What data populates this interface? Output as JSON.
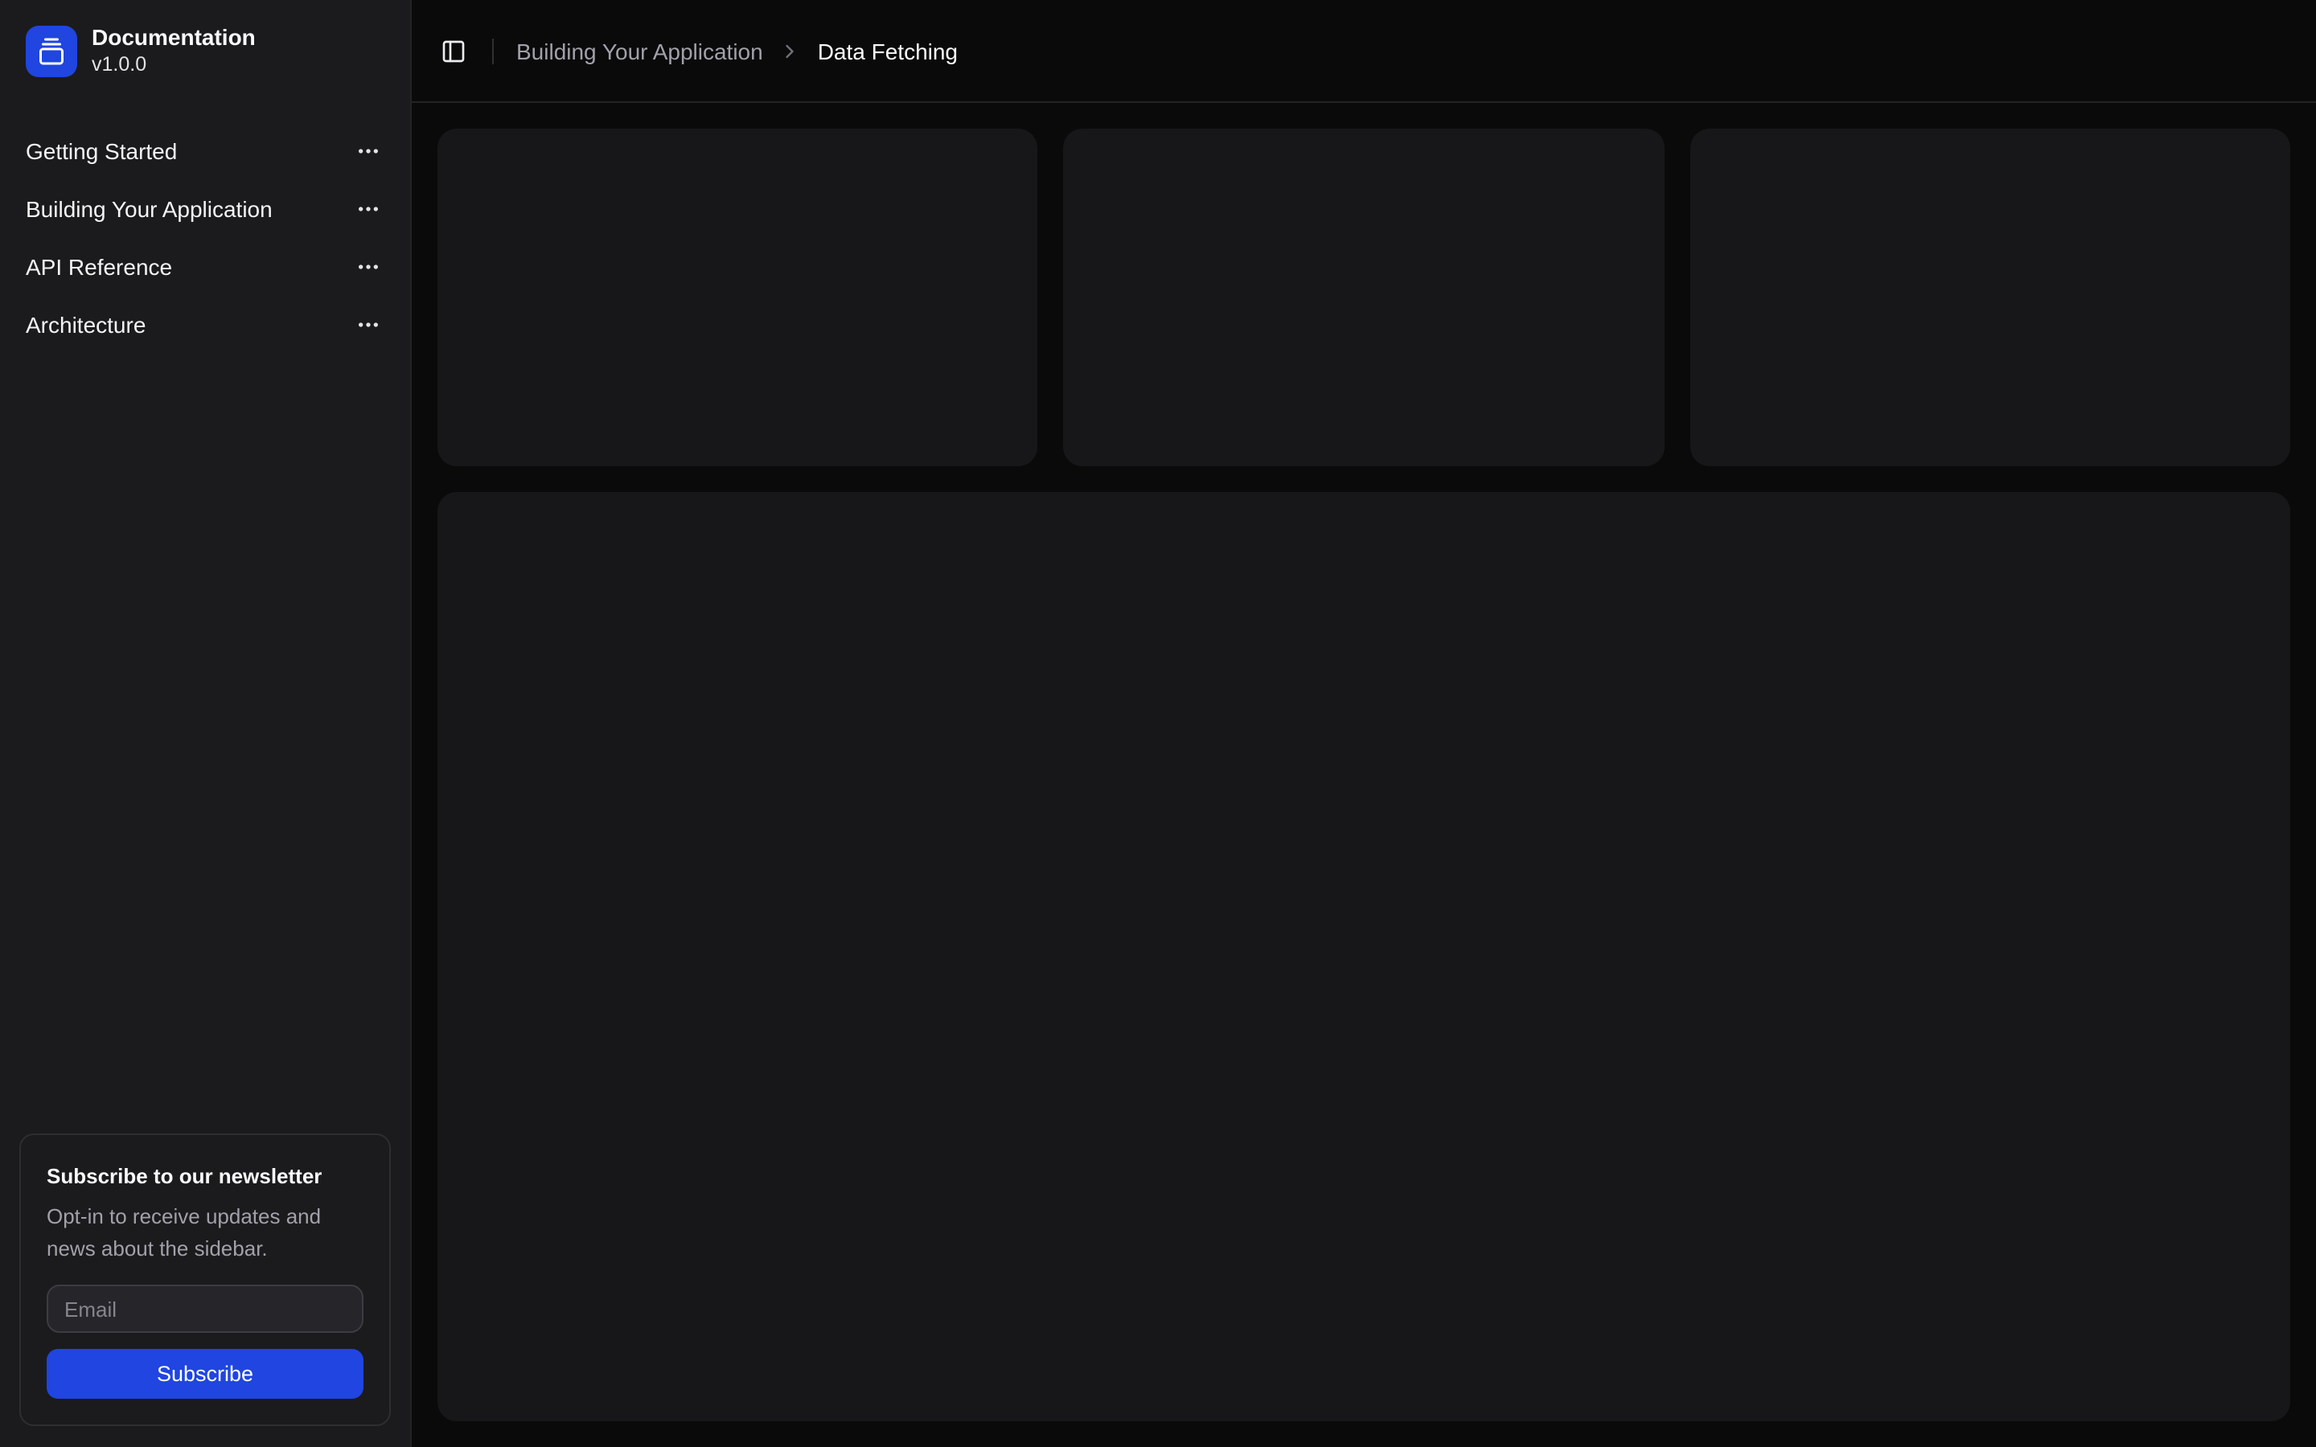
{
  "sidebar": {
    "title": "Documentation",
    "version": "v1.0.0",
    "items": [
      {
        "label": "Getting Started"
      },
      {
        "label": "Building Your Application"
      },
      {
        "label": "API Reference"
      },
      {
        "label": "Architecture"
      }
    ],
    "newsletter": {
      "title": "Subscribe to our newsletter",
      "description": "Opt-in to receive updates and news about the sidebar.",
      "email_placeholder": "Email",
      "subscribe_label": "Subscribe"
    }
  },
  "header": {
    "breadcrumb": [
      {
        "label": "Building Your Application"
      },
      {
        "label": "Data Fetching"
      }
    ]
  },
  "icons": {
    "logo": "gallery-vertical-end-icon",
    "menu_action": "ellipsis-icon",
    "sidebar_toggle": "panel-left-icon",
    "breadcrumb_separator": "chevron-right-icon"
  },
  "colors": {
    "primary": "#2045e0",
    "bg_main": "#0a0a0b",
    "bg_sidebar": "#1b1b1d",
    "bg_placeholder": "#171719",
    "bg_input": "#26262a",
    "border_subtle": "#232326",
    "border_card": "#2e2e32",
    "border_input": "#3c3c42",
    "text": "#fafafa",
    "muted": "#a1a1aa",
    "placeholder": "#85858d",
    "chevron": "#71717a"
  },
  "main": {
    "placeholder_top_cards": 3,
    "placeholder_large_cards": 1
  }
}
